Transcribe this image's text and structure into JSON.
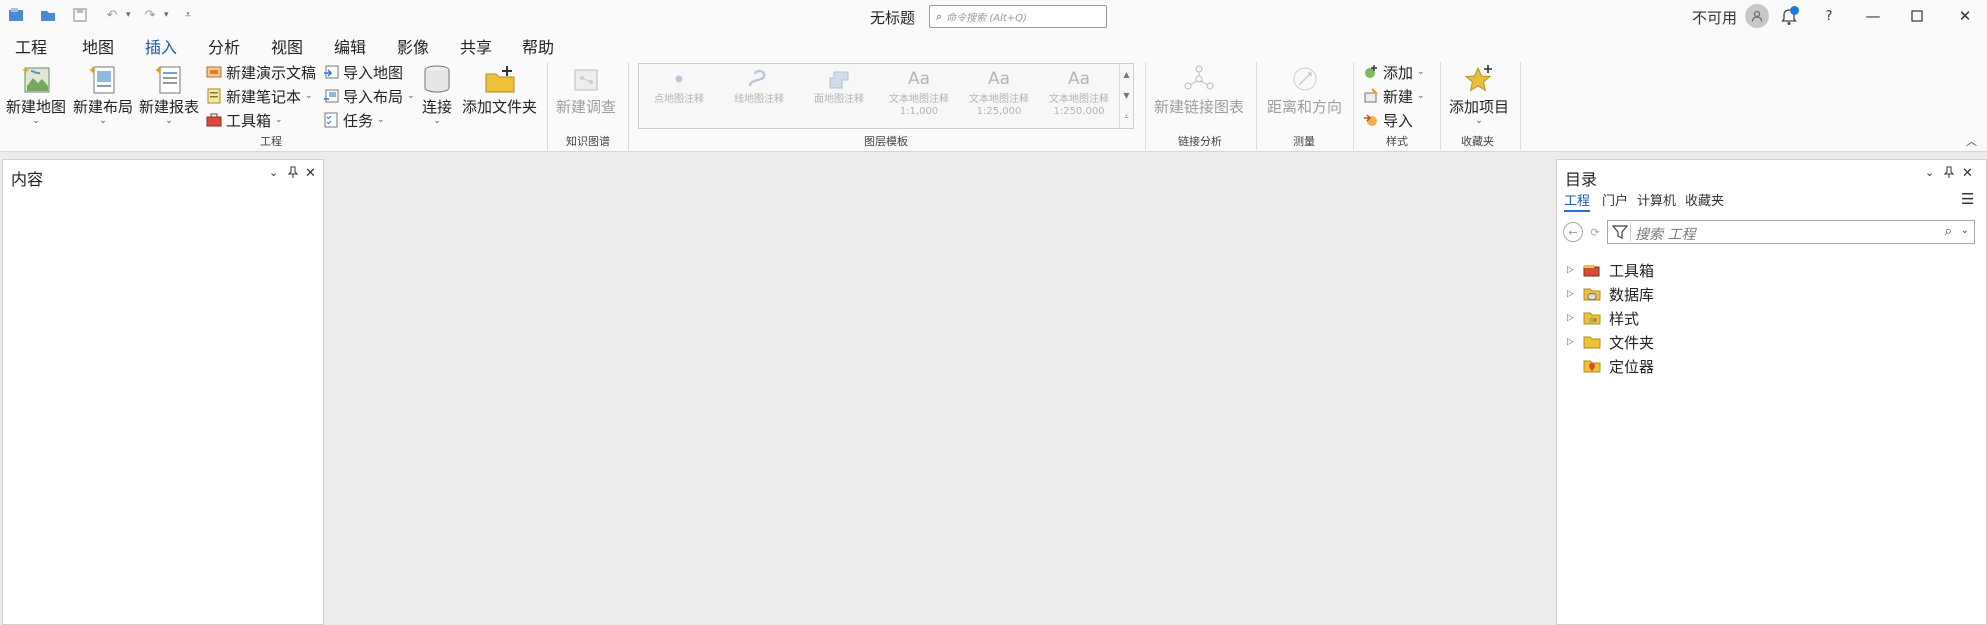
{
  "titlebar": {
    "title": "无标题",
    "search_placeholder": "命令搜索 (Alt+Q)",
    "status": "不可用",
    "help_label": "?"
  },
  "menu": {
    "tabs": [
      "工程",
      "地图",
      "插入",
      "分析",
      "视图",
      "编辑",
      "影像",
      "共享",
      "帮助"
    ],
    "active": "插入"
  },
  "ribbon": {
    "project_group": {
      "label": "工程",
      "new_map": "新建地图",
      "new_layout": "新建布局",
      "new_report": "新建报表",
      "new_presentation": "新建演示文稿",
      "new_notebook": "新建笔记本",
      "toolbox": "工具箱",
      "import_map": "导入地图",
      "import_layout": "导入布局",
      "task": "任务",
      "connect": "连接",
      "add_folder": "添加文件夹"
    },
    "knowledge_group": {
      "label": "知识图谱",
      "new_investigation": "新建调查"
    },
    "layer_templates": {
      "label": "图层模板",
      "items": [
        {
          "line1": "点地图注释",
          "line2": ""
        },
        {
          "line1": "线地图注释",
          "line2": ""
        },
        {
          "line1": "面地图注释",
          "line2": ""
        },
        {
          "line1": "文本地图注释",
          "line2": "1:1,000"
        },
        {
          "line1": "文本地图注释",
          "line2": "1:25,000"
        },
        {
          "line1": "文本地图注释",
          "line2": "1:250,000"
        }
      ]
    },
    "link_analysis": {
      "label": "链接分析",
      "new_link_chart": "新建链接图表"
    },
    "measure": {
      "label": "测量",
      "distance_direction": "距离和方向"
    },
    "styles": {
      "label": "样式",
      "add": "添加",
      "new": "新建",
      "import": "导入"
    },
    "favorites": {
      "label": "收藏夹",
      "add_item": "添加项目"
    }
  },
  "contents_pane": {
    "title": "内容"
  },
  "catalog_pane": {
    "title": "目录",
    "tabs": [
      "工程",
      "门户",
      "计算机",
      "收藏夹"
    ],
    "active_tab": "工程",
    "search_placeholder": "搜索 工程",
    "tree": [
      {
        "label": "工具箱",
        "expandable": true
      },
      {
        "label": "数据库",
        "expandable": true
      },
      {
        "label": "样式",
        "expandable": true
      },
      {
        "label": "文件夹",
        "expandable": true
      },
      {
        "label": "定位器",
        "expandable": false
      }
    ]
  },
  "colors": {
    "accent": "#2a6ec8",
    "folder": "#e8b92a",
    "notification": "#1c7ad4"
  }
}
